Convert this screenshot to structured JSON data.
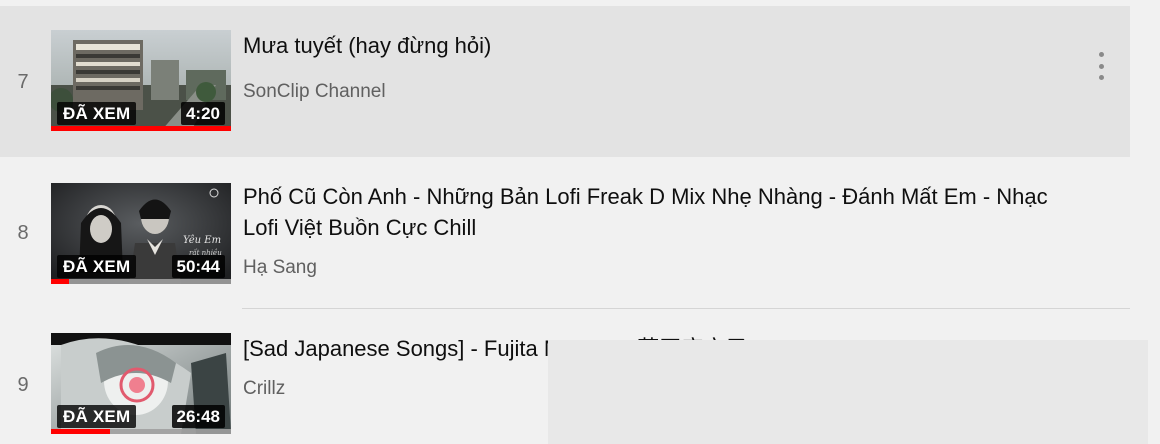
{
  "playlist": {
    "items": [
      {
        "index": "7",
        "title": "Mưa tuyết (hay đừng hỏi)",
        "channel": "SonClip Channel",
        "watched_label": "ĐÃ XEM",
        "duration": "4:20",
        "watch_progress_pct": 100,
        "selected": true,
        "menu_icon": "more-vertical-icon"
      },
      {
        "index": "8",
        "title": "Phố Cũ Còn Anh - Những Bản Lofi Freak D Mix Nhẹ Nhàng - Đánh Mất Em - Nhạc Lofi Việt Buồn Cực Chill",
        "channel": "Hạ Sang",
        "watched_label": "ĐÃ XEM",
        "duration": "50:44",
        "watch_progress_pct": 10,
        "selected": false
      },
      {
        "index": "9",
        "title": "[Sad Japanese Songs] - Fujita Maiko's ( 藤田麻衣子) Playlist",
        "channel": "Crillz",
        "watched_label": "ĐÃ XEM",
        "duration": "26:48",
        "watch_progress_pct": 33,
        "selected": false
      }
    ]
  },
  "colors": {
    "page_background": "#f1f1f1",
    "selected_row_background": "#e3e3e3",
    "progress_red": "#ff0000",
    "title_text": "#0f0f0f",
    "secondary_text": "#606060"
  }
}
